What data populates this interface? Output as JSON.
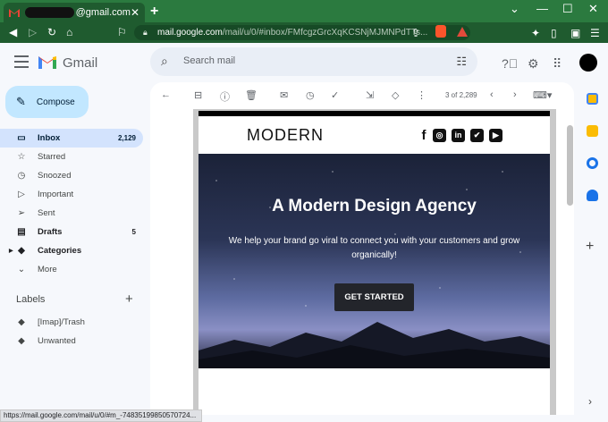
{
  "browser": {
    "tab_title_suffix": "@gmail.com",
    "url_host": "mail.google.com",
    "url_path": "/mail/u/0/#inbox/FMfcgzGrcXqKCSNjMJMNPdTTs..."
  },
  "gmail": {
    "brand": "Gmail",
    "search_placeholder": "Search mail",
    "compose_label": "Compose",
    "nav": [
      {
        "label": "Inbox",
        "count": "2,129"
      },
      {
        "label": "Starred",
        "count": ""
      },
      {
        "label": "Snoozed",
        "count": ""
      },
      {
        "label": "Important",
        "count": ""
      },
      {
        "label": "Sent",
        "count": ""
      },
      {
        "label": "Drafts",
        "count": "5"
      },
      {
        "label": "Categories",
        "count": ""
      },
      {
        "label": "More",
        "count": ""
      }
    ],
    "labels_heading": "Labels",
    "labels": [
      {
        "label": "[Imap]/Trash"
      },
      {
        "label": "Unwanted"
      }
    ],
    "pager": "3 of 2,289"
  },
  "email": {
    "logo_text": "MODERN",
    "headline": "A Modern Design Agency",
    "body": "We help your brand go viral to connect you with your customers and grow organically!",
    "cta": "GET STARTED"
  },
  "status_bar": "https://mail.google.com/mail/u/0/#m_-74835199850570724..."
}
